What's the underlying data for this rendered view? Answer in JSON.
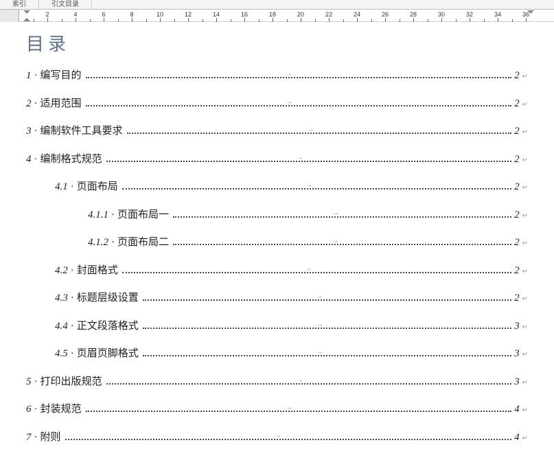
{
  "tabs": {
    "index": "索引",
    "citation_toc": "引文目录"
  },
  "ruler": {
    "numbers": [
      "2",
      "4",
      "6",
      "8",
      "10",
      "12",
      "14",
      "16",
      "18",
      "20",
      "22",
      "24",
      "26",
      "28",
      "30",
      "32",
      "34",
      "36"
    ]
  },
  "toc": {
    "title": "目录",
    "entries": [
      {
        "level": 1,
        "num": "1",
        "label": "编写目的",
        "page": "2"
      },
      {
        "level": 1,
        "num": "2",
        "label": "适用范围",
        "page": "2"
      },
      {
        "level": 1,
        "num": "3",
        "label": "编制软件工具要求",
        "page": "2"
      },
      {
        "level": 1,
        "num": "4",
        "label": "编制格式规范",
        "page": "2"
      },
      {
        "level": 2,
        "num": "4.1",
        "label": "页面布局",
        "page": "2"
      },
      {
        "level": 3,
        "num": "4.1.1",
        "label": "页面布局一",
        "page": "2"
      },
      {
        "level": 3,
        "num": "4.1.2",
        "label": "页面布局二",
        "page": "2"
      },
      {
        "level": 2,
        "num": "4.2",
        "label": "封面格式",
        "page": "2"
      },
      {
        "level": 2,
        "num": "4.3",
        "label": "标题层级设置",
        "page": "2"
      },
      {
        "level": 2,
        "num": "4.4",
        "label": "正文段落格式",
        "page": "3"
      },
      {
        "level": 2,
        "num": "4.5",
        "label": "页眉页脚格式",
        "page": "3"
      },
      {
        "level": 1,
        "num": "5",
        "label": "打印出版规范",
        "page": "3"
      },
      {
        "level": 1,
        "num": "6",
        "label": "封装规范",
        "page": "4"
      },
      {
        "level": 1,
        "num": "7",
        "label": "附则",
        "page": "4"
      }
    ]
  },
  "glyphs": {
    "dot": "·",
    "tab": "→",
    "ret": "↵"
  }
}
